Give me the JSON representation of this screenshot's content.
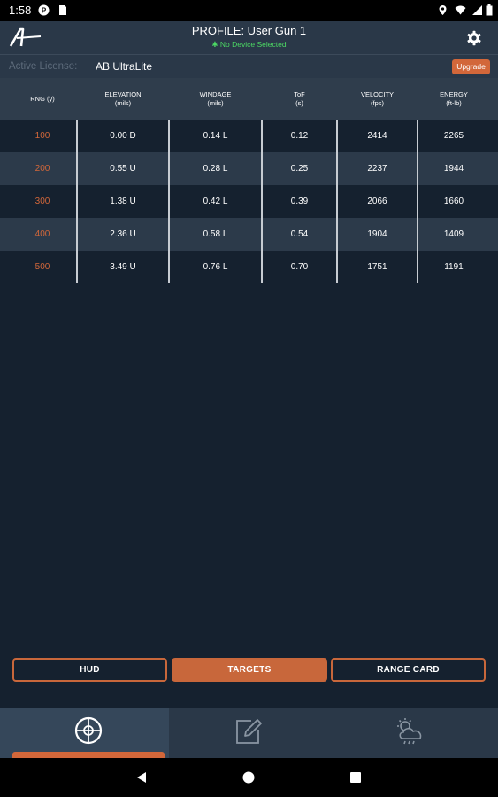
{
  "status_bar": {
    "time": "1:58"
  },
  "header": {
    "profile_title": "PROFILE: User Gun 1",
    "device_status": "No Device Selected",
    "logo_icon": "a-logo-icon",
    "settings_icon": "gear-icon"
  },
  "license": {
    "label": "Active License:",
    "value": "AB UltraLite",
    "upgrade_label": "Upgrade"
  },
  "table": {
    "headers": [
      {
        "line1": "RNG (y)",
        "line2": ""
      },
      {
        "line1": "ELEVATION",
        "line2": "(mils)"
      },
      {
        "line1": "WINDAGE",
        "line2": "(mils)"
      },
      {
        "line1": "ToF",
        "line2": "(s)"
      },
      {
        "line1": "VELOCITY",
        "line2": "(fps)"
      },
      {
        "line1": "ENERGY",
        "line2": "(ft-lb)"
      }
    ],
    "rows": [
      [
        "100",
        "0.00 D",
        "0.14 L",
        "0.12",
        "2414",
        "2265"
      ],
      [
        "200",
        "0.55 U",
        "0.28 L",
        "0.25",
        "2237",
        "1944"
      ],
      [
        "300",
        "1.38 U",
        "0.42 L",
        "0.39",
        "2066",
        "1660"
      ],
      [
        "400",
        "2.36 U",
        "0.58 L",
        "0.54",
        "1904",
        "1409"
      ],
      [
        "500",
        "3.49 U",
        "0.76 L",
        "0.70",
        "1751",
        "1191"
      ]
    ]
  },
  "buttons": {
    "hud": "HUD",
    "targets": "TARGETS",
    "range_card": "RANGE CARD"
  },
  "bottom_nav": {
    "tabs": [
      {
        "icon": "crosshair-icon"
      },
      {
        "icon": "edit-icon"
      },
      {
        "icon": "weather-icon"
      }
    ]
  },
  "colors": {
    "accent": "#d2673a",
    "background": "#15212f",
    "status_green": "#4cd964"
  }
}
